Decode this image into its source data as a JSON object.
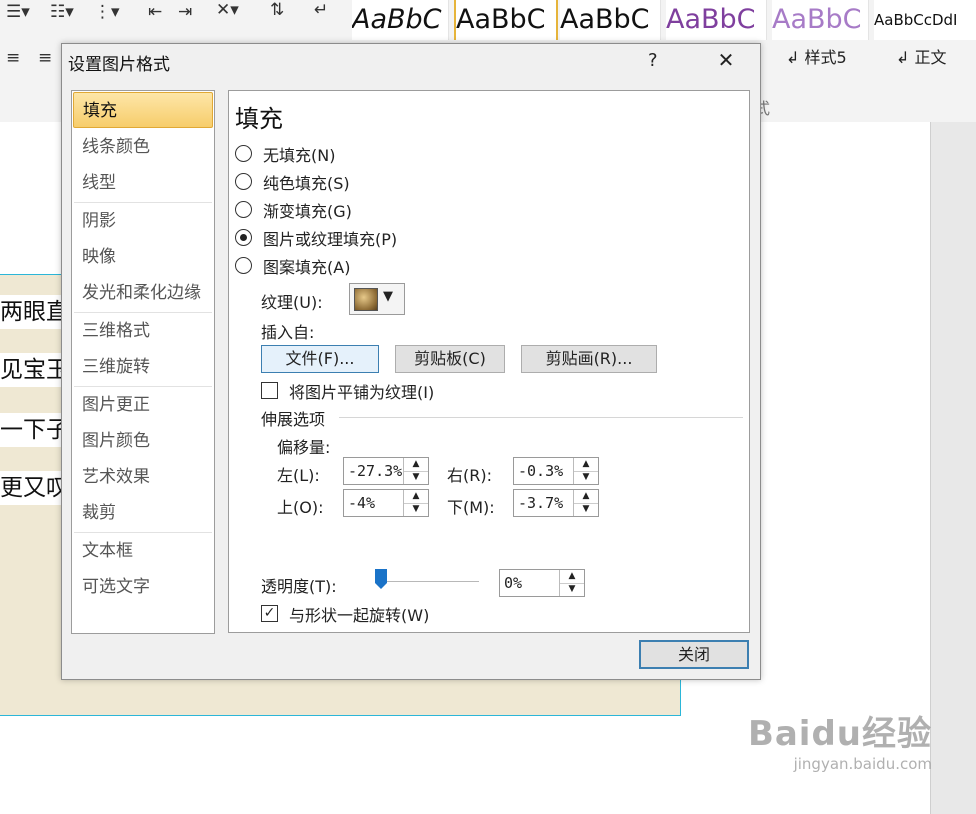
{
  "ribbon": {
    "styles_row1": [
      "AaBbC",
      "AaBbC",
      "AaBbC",
      "AaBbC",
      "AaBbC",
      "AaBbCcDdI"
    ],
    "style_names": [
      "样式5",
      "正文"
    ],
    "group_label_fragment": "式"
  },
  "document": {
    "lines": [
      "两眼直",
      "见宝玉",
      "一下子",
      "更又叹"
    ]
  },
  "watermark": {
    "brand": "Baidu经验",
    "url": "jingyan.baidu.com"
  },
  "dialog": {
    "title": "设置图片格式",
    "help": "?",
    "close_glyph": "✕",
    "nav": [
      {
        "label": "填充",
        "selected": true
      },
      {
        "label": "线条颜色"
      },
      {
        "label": "线型"
      },
      {
        "label": "阴影"
      },
      {
        "label": "映像"
      },
      {
        "label": "发光和柔化边缘"
      },
      {
        "label": "三维格式"
      },
      {
        "label": "三维旋转"
      },
      {
        "label": "图片更正"
      },
      {
        "label": "图片颜色"
      },
      {
        "label": "艺术效果"
      },
      {
        "label": "裁剪"
      },
      {
        "label": "文本框"
      },
      {
        "label": "可选文字"
      }
    ],
    "panel": {
      "heading": "填充",
      "fill_options": [
        {
          "label": "无填充(N)",
          "checked": false
        },
        {
          "label": "纯色填充(S)",
          "checked": false
        },
        {
          "label": "渐变填充(G)",
          "checked": false
        },
        {
          "label": "图片或纹理填充(P)",
          "checked": true
        },
        {
          "label": "图案填充(A)",
          "checked": false
        }
      ],
      "texture_label": "纹理(U):",
      "insert_from_label": "插入自:",
      "file_button": "文件(F)...",
      "clipboard_button": "剪贴板(C)",
      "clipart_button": "剪贴画(R)...",
      "tile_checkbox": "将图片平铺为纹理(I)",
      "tile_checked": false,
      "stretch_heading": "伸展选项",
      "offset_label": "偏移量:",
      "offsets": {
        "left_label": "左(L):",
        "left_value": "-27.3%",
        "right_label": "右(R):",
        "right_value": "-0.3%",
        "top_label": "上(O):",
        "top_value": "-4%",
        "bottom_label": "下(M):",
        "bottom_value": "-3.7%"
      },
      "transparency_label": "透明度(T):",
      "transparency_value": "0%",
      "transparency_fraction": 0,
      "rotate_checkbox": "与形状一起旋转(W)",
      "rotate_checked": true
    },
    "close_button": "关闭"
  },
  "colors": {
    "nav_selected": "#f7cd6b",
    "slider_thumb": "#1a73c8",
    "picture_fill": "#efe8d3",
    "picture_border": "#2bb6d8",
    "style_purple": "#7f3f9e",
    "style_purple_light": "#a77bc7"
  }
}
